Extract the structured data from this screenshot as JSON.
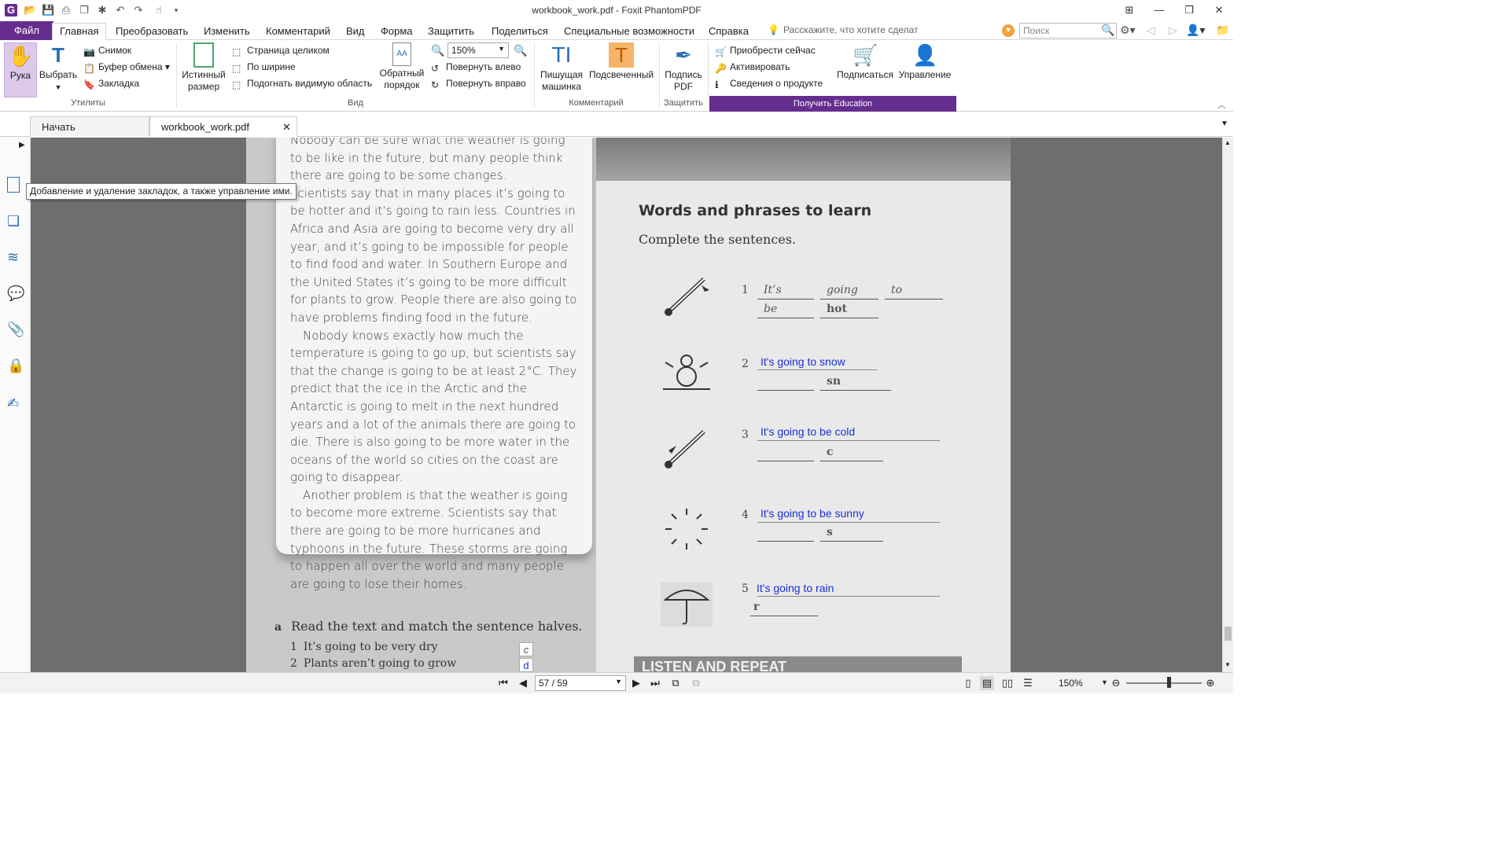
{
  "app": {
    "title": "workbook_work.pdf - Foxit PhantomPDF"
  },
  "menu": {
    "file": "Файл",
    "tabs": [
      "Главная",
      "Преобразовать",
      "Изменить",
      "Комментарий",
      "Вид",
      "Форма",
      "Защитить",
      "Поделиться",
      "Специальные возможности",
      "Справка"
    ],
    "tell_me": "Расскажите, что хотите сделат",
    "search_placeholder": "Поиск"
  },
  "ribbon": {
    "hand": "Рука",
    "select": "Выбрать",
    "snapshot": "Снимок",
    "clipboard": "Буфер обмена",
    "bookmark": "Закладка",
    "group_utilities": "Утилиты",
    "actual_size": "Истинный размер",
    "fit_page": "Страница целиком",
    "fit_width": "По ширине",
    "fit_visible": "Подогнать видимую область",
    "reverse_order": "Обратный порядок",
    "zoom_value": "150%",
    "rotate_left": "Повернуть влево",
    "rotate_right": "Повернуть вправо",
    "group_view": "Вид",
    "typewriter": "Пишущая машинка",
    "highlight": "Подсвеченный",
    "group_comment": "Комментарий",
    "sign_pdf": "Подпись PDF",
    "group_protect": "Защитить",
    "buy_now": "Приобрести сейчас",
    "activate": "Активировать",
    "product_info": "Сведения о продукте",
    "subscribe": "Подписаться",
    "manage": "Управление",
    "get_education": "Получить Education"
  },
  "tabs": {
    "start": "Начать",
    "document": "workbook_work.pdf"
  },
  "tooltip": "Добавление и удаление закладок, а также управление ими.",
  "doc": {
    "reading_paragraphs": [
      "Nobody can be sure what the weather is going to be like in the future, but many people think there are going to be some changes.",
      "Scientists say that in many places it’s going to be hotter and it’s going to rain less. Countries in Africa and Asia are going to become very dry all year, and it’s going to be impossible for people to find food and water. In Southern Europe and the United States it’s going to be more difficult for plants to grow. People there are also going to have problems finding food in the future.",
      "Nobody knows exactly how much the temperature is going to go up, but scientists say that the change is going to be at least 2°C. They predict that the ice in the Arctic and the Antarctic is going to melt in the next hundred years and a lot of the animals there are going to die. There is also going to be more water in the oceans of the world so cities on the coast are going to disappear.",
      "Another problem is that the weather is going to become more extreme. Scientists say that there are going to be more hurricanes and typhoons in the future. These storms are going to happen all over the world and many people are going to lose their homes."
    ],
    "section_title": "Words and phrases to learn",
    "instruction": "Complete the sentences.",
    "exercises": [
      {
        "num": "1",
        "line1": [
          "It’s",
          "going",
          "to"
        ],
        "line2": [
          "be",
          "hot"
        ]
      },
      {
        "num": "2",
        "answer": "It's going to snow",
        "hint": "sn"
      },
      {
        "num": "3",
        "answer": "It's going to be cold",
        "hint": "c"
      },
      {
        "num": "4",
        "answer": "It's going to be sunny",
        "hint": "s"
      },
      {
        "num": "5",
        "answer": "It's going to rain",
        "hint": "r"
      }
    ],
    "part_a_letter": "a",
    "part_a_text": "Read the text and match the sentence halves.",
    "match": [
      {
        "num": "1",
        "text": "It’s going to be very dry",
        "answer": "c"
      },
      {
        "num": "2",
        "text": "Plants aren’t going to grow",
        "answer": "d"
      }
    ],
    "banner": "LISTEN AND REPEAT"
  },
  "status": {
    "page": "57 / 59",
    "zoom": "150%"
  },
  "colors": {
    "brand": "#652e8e",
    "answer_blue": "#1a2fd6"
  }
}
